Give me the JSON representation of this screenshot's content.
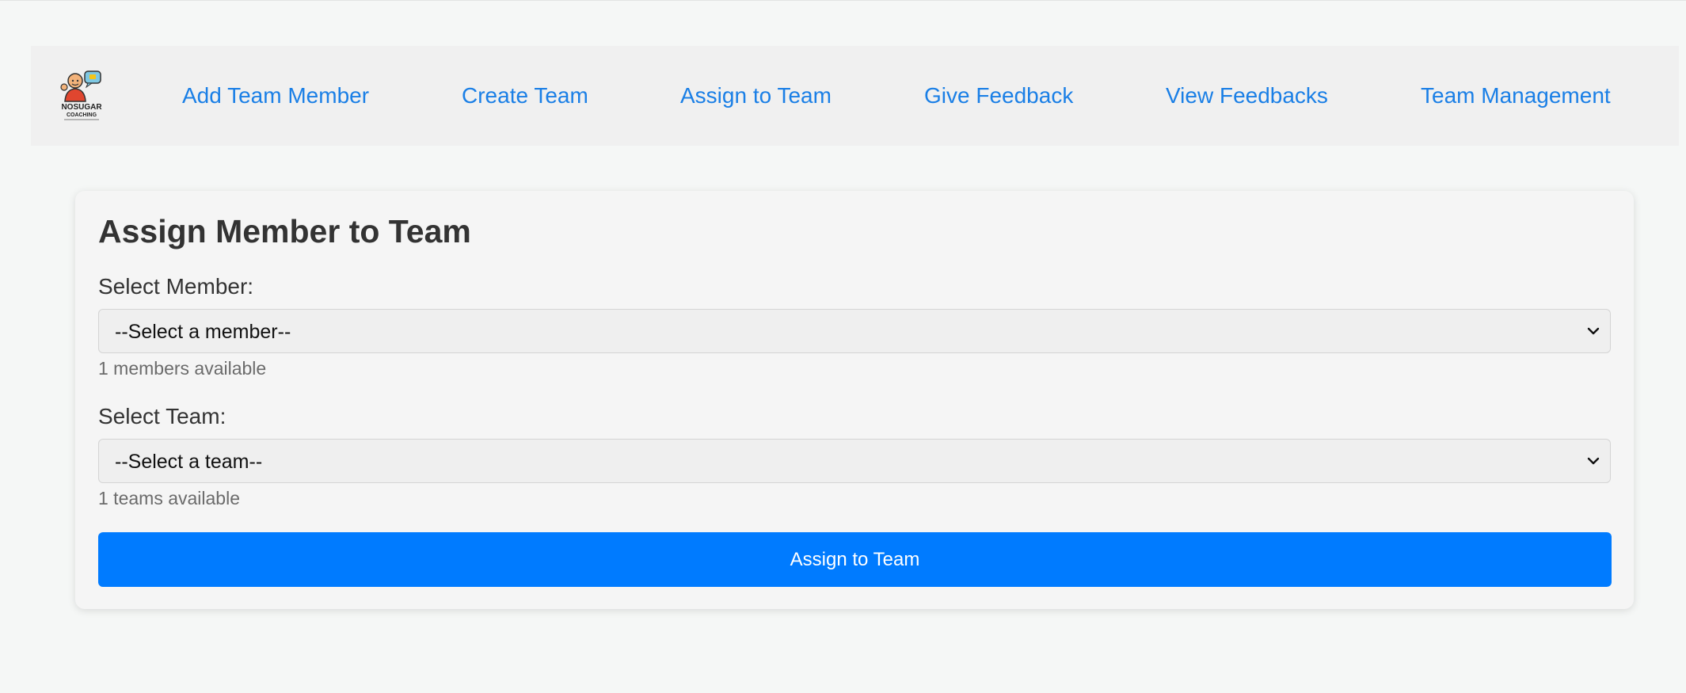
{
  "nav": {
    "logo_text": "NOSUGAR COACHING",
    "links": [
      {
        "label": "Add Team Member"
      },
      {
        "label": "Create Team"
      },
      {
        "label": "Assign to Team"
      },
      {
        "label": "Give Feedback"
      },
      {
        "label": "View Feedbacks"
      },
      {
        "label": "Team Management"
      }
    ],
    "link_color": "#1a7fe6"
  },
  "form": {
    "title": "Assign Member to Team",
    "member": {
      "label": "Select Member:",
      "selected": "--Select a member--",
      "helper": "1 members available"
    },
    "team": {
      "label": "Select Team:",
      "selected": "--Select a team--",
      "helper": "1 teams available"
    },
    "submit_label": "Assign to Team",
    "submit_color": "#007bff"
  }
}
